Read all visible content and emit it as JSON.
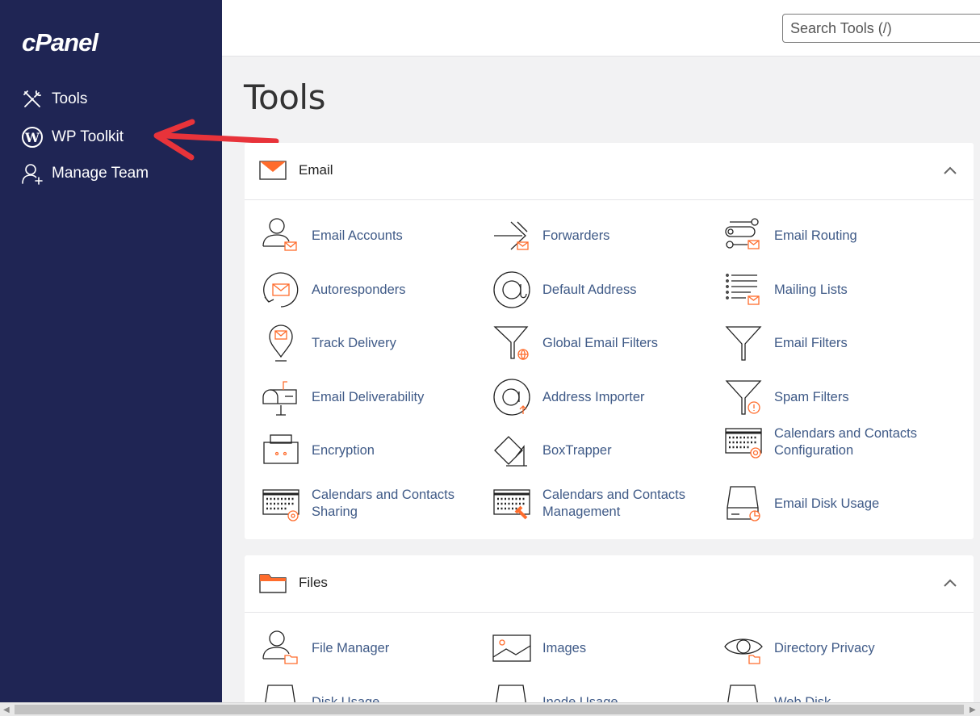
{
  "brand": "cPanel",
  "sidebar": {
    "items": [
      {
        "label": "Tools",
        "icon": "tools-icon"
      },
      {
        "label": "WP Toolkit",
        "icon": "wordpress-icon"
      },
      {
        "label": "Manage Team",
        "icon": "manage-team-icon"
      }
    ]
  },
  "search": {
    "placeholder": "Search Tools (/)"
  },
  "page_title": "Tools",
  "colors": {
    "sidebar": "#1f2554",
    "accent": "#ff6c2c",
    "link": "#3f5a87",
    "arrow": "#e8333a"
  },
  "sections": {
    "email": {
      "title": "Email",
      "tools": [
        [
          "Email Accounts",
          "Forwarders",
          "Email Routing"
        ],
        [
          "Autoresponders",
          "Default Address",
          "Mailing Lists"
        ],
        [
          "Track Delivery",
          "Global Email Filters",
          "Email Filters"
        ],
        [
          "Email Deliverability",
          "Address Importer",
          "Spam Filters"
        ],
        [
          "Encryption",
          "BoxTrapper",
          "Calendars and Contacts Configuration"
        ],
        [
          "Calendars and Contacts Sharing",
          "Calendars and Contacts Management",
          "Email Disk Usage"
        ]
      ]
    },
    "files": {
      "title": "Files",
      "tools": [
        [
          "File Manager",
          "Images",
          "Directory Privacy"
        ],
        [
          "Disk Usage",
          "Inode Usage",
          "Web Disk"
        ]
      ]
    }
  }
}
